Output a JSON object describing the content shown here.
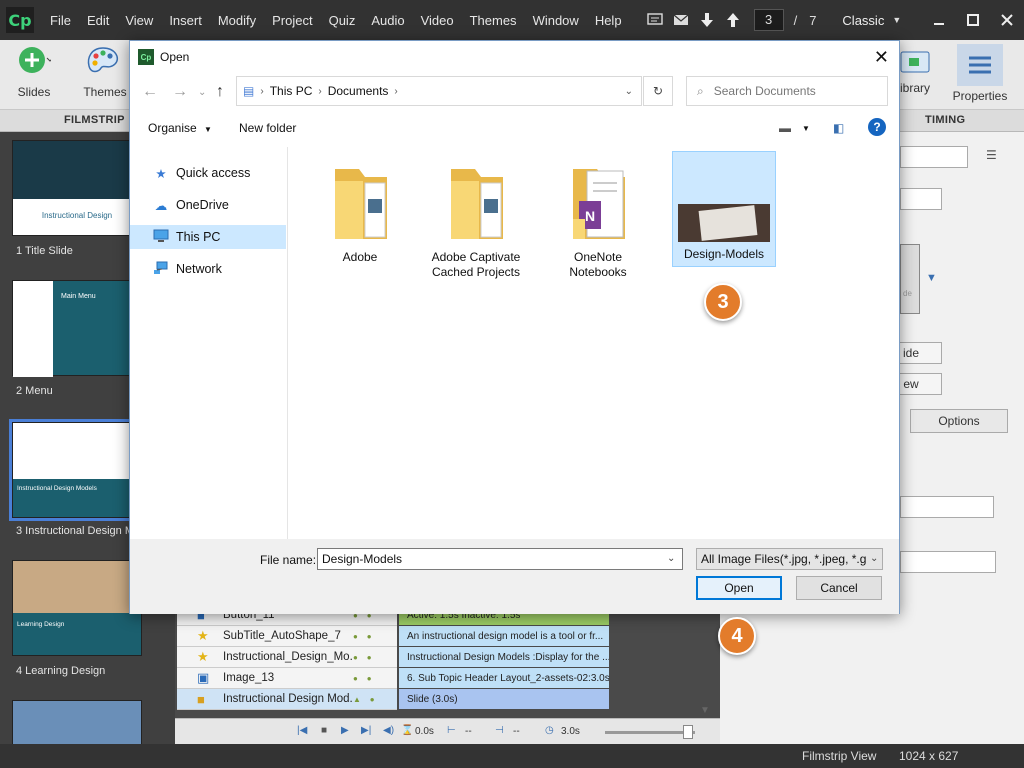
{
  "app": {
    "logo": "Cp",
    "menu": [
      "File",
      "Edit",
      "View",
      "Insert",
      "Modify",
      "Project",
      "Quiz",
      "Audio",
      "Video",
      "Themes",
      "Window",
      "Help"
    ],
    "current_slide": "3",
    "slide_sep": "/",
    "total_slides": "7",
    "mode": "Classic"
  },
  "toolbar": {
    "slides_label": "Slides",
    "themes_label": "Themes",
    "library_label": "ibrary",
    "properties_label": "Properties"
  },
  "panel_tabs": {
    "filmstrip": "FILMSTRIP",
    "timing": "TIMING"
  },
  "filmstrip": {
    "slides": [
      {
        "label": "1 Title Slide",
        "thumb_text": "Instructional Design"
      },
      {
        "label": "2 Menu",
        "thumb_text": "Main Menu"
      },
      {
        "label": "3 Instructional Design M...",
        "thumb_text": "Instructional Design Models"
      },
      {
        "label": "4 Learning Design",
        "thumb_text": "Learning Design"
      }
    ]
  },
  "props": {
    "btn_ide": "ide",
    "btn_ew": "ew",
    "options_tab": "Options",
    "thumb_caption": "de"
  },
  "timeline": {
    "rows": [
      {
        "name": "Button_11",
        "bar": "Active: 1.5s        Inactive: 1.5s",
        "icon": "button"
      },
      {
        "name": "SubTitle_AutoShape_7",
        "bar": "An instructional design model is a tool or fr...",
        "icon": "star"
      },
      {
        "name": "Instructional_Design_Mo...",
        "bar": "Instructional Design Models :Display for the ...",
        "icon": "star"
      },
      {
        "name": "Image_13",
        "bar": "6. Sub Topic Header Layout_2-assets-02:3.0s",
        "icon": "image"
      },
      {
        "name": "Instructional Design Mod...",
        "bar": "Slide (3.0s)",
        "icon": "slide"
      }
    ],
    "footer": {
      "start": "0.0s",
      "duration": "3.0s",
      "dash1": "--",
      "dash2": "--"
    }
  },
  "statusbar": {
    "view": "Filmstrip View",
    "size": "1024 x 627"
  },
  "dialog": {
    "title": "Open",
    "breadcrumb": [
      "This PC",
      "Documents"
    ],
    "search_placeholder": "Search Documents",
    "organise": "Organise",
    "new_folder": "New folder",
    "nav": [
      {
        "label": "Quick access",
        "icon": "star-icon"
      },
      {
        "label": "OneDrive",
        "icon": "cloud-icon"
      },
      {
        "label": "This PC",
        "icon": "computer-icon"
      },
      {
        "label": "Network",
        "icon": "network-icon"
      }
    ],
    "files": [
      {
        "name": "Adobe"
      },
      {
        "name": "Adobe Captivate Cached Projects"
      },
      {
        "name": "OneNote Notebooks"
      },
      {
        "name": "Design-Models"
      }
    ],
    "file_name_label": "File name:",
    "file_name_value": "Design-Models",
    "file_type": "All Image Files(*.jpg, *.jpeg, *.g",
    "open_label": "Open",
    "cancel_label": "Cancel"
  },
  "callouts": {
    "step3": "3",
    "step4": "4"
  },
  "colors": {
    "accent": "#0078d7",
    "callout": "#e37c2b",
    "selection": "#cce8ff"
  }
}
